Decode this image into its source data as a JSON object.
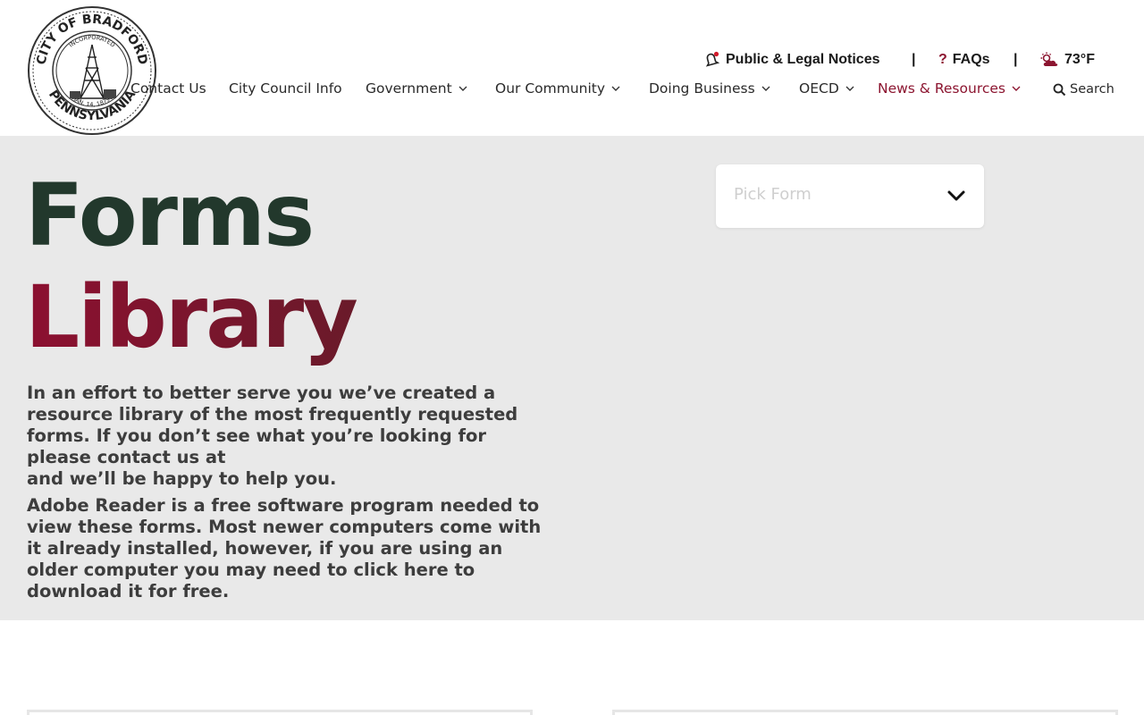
{
  "header": {
    "logo": {
      "ring_top": "CITY OF BRADFORD",
      "ring_bottom": "PENNSYLVANIA",
      "inner_top": "INCORPORATED",
      "inner_bottom": "JAN. 14, 1879"
    },
    "utility": {
      "notices_label": "Public & Legal Notices",
      "separator": "|",
      "faqs_label": "FAQs",
      "faqs_prefix": "?",
      "temperature": "73°F"
    },
    "nav": {
      "items": [
        {
          "label": "Contact Us",
          "has_dropdown": false
        },
        {
          "label": "City Council Info",
          "has_dropdown": false
        },
        {
          "label": "Government",
          "has_dropdown": true
        },
        {
          "label": "Our Community",
          "has_dropdown": true
        },
        {
          "label": "Doing Business",
          "has_dropdown": true
        },
        {
          "label": "OECD",
          "has_dropdown": true
        },
        {
          "label": "News & Resources",
          "has_dropdown": true,
          "active": true
        }
      ],
      "search_label": "Search"
    }
  },
  "hero": {
    "title_line1": "Forms",
    "title_line2": "Library",
    "paragraph1": "In an effort to better serve you we’ve created a resource library of the most frequently requested forms. If you don’t see what you’re looking for please contact us at",
    "paragraph1_end": "and we’ll be happy to help you.",
    "paragraph2": "Adobe Reader is a free software program needed to view these forms. Most newer computers come with it already installed, however, if you are using an older computer you may need to click here to download it for free.",
    "picker_placeholder": "Pick Form"
  },
  "colors": {
    "accent": "#8c1530",
    "title_green": "#22382c",
    "hero_bg": "#e9e9e9"
  }
}
